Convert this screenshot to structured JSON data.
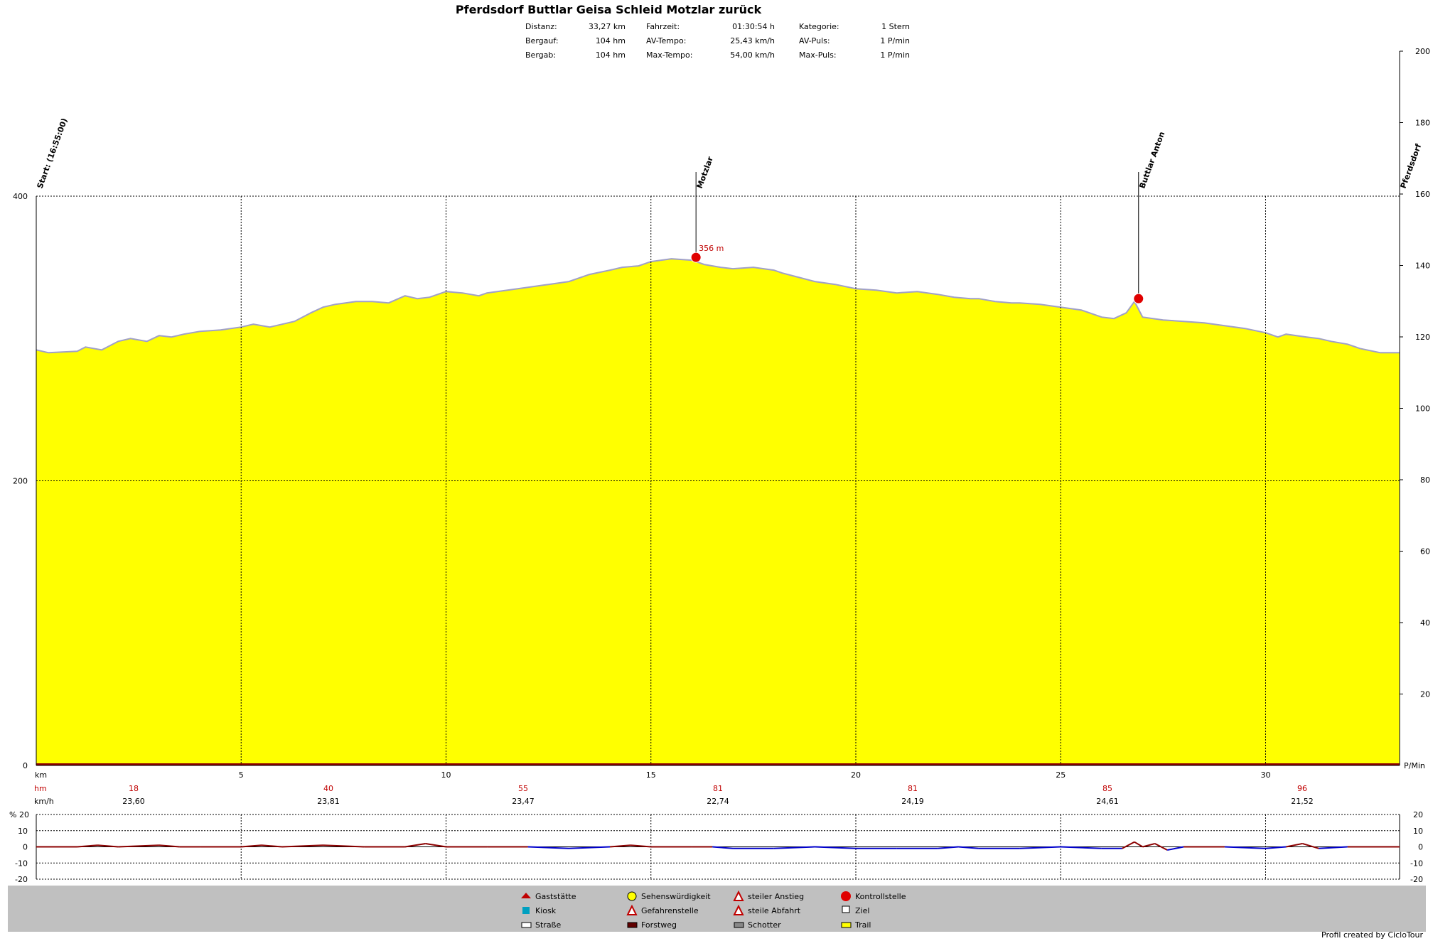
{
  "title": "Pferdsdorf Buttlar Geisa Schleid Motzlar zurück",
  "stats": [
    [
      {
        "label": "Distanz:",
        "value": "33,27 km"
      },
      {
        "label": "Fahrzeit:",
        "value": "01:30:54 h"
      },
      {
        "label": "Kategorie:",
        "value": "1 Stern"
      }
    ],
    [
      {
        "label": "Bergauf:",
        "value": "104 hm"
      },
      {
        "label": "AV-Tempo:",
        "value": "25,43 km/h"
      },
      {
        "label": "AV-Puls:",
        "value": "1 P/min"
      }
    ],
    [
      {
        "label": "Bergab:",
        "value": "104 hm"
      },
      {
        "label": "Max-Tempo:",
        "value": "54,00 km/h"
      },
      {
        "label": "Max-Puls:",
        "value": "1 P/min"
      }
    ]
  ],
  "labels": {
    "km": "km",
    "hm": "hm",
    "kmh": "km/h",
    "pmin": "P/Min",
    "percent": "% 20",
    "credit": "Profil created by CicloTour",
    "peak": "356 m"
  },
  "colors": {
    "fill": "#ffff00",
    "outline": "#a0a0c8",
    "hm_text": "#c00000",
    "legend_bg": "#c0c0c0",
    "grade_up": "#8b0000",
    "grade_down": "#0000cc"
  },
  "chart_data": [
    {
      "type": "area",
      "xlabel": "km",
      "ylabel": "",
      "xlim": [
        0,
        33.27
      ],
      "ylim": [
        0,
        400
      ],
      "y2lim": [
        0,
        200
      ],
      "x_ticks": [
        5,
        10,
        15,
        20,
        25,
        30
      ],
      "y_ticks": [
        0,
        200,
        400
      ],
      "y2_ticks": [
        20,
        40,
        60,
        80,
        100,
        120,
        140,
        160,
        180,
        200
      ],
      "grid": true,
      "elevation_profile": {
        "x": [
          0,
          0.3,
          1,
          1.2,
          1.6,
          2,
          2.3,
          2.7,
          3,
          3.3,
          3.6,
          4,
          4.5,
          5,
          5.3,
          5.7,
          6,
          6.3,
          6.7,
          7,
          7.3,
          7.8,
          8.2,
          8.6,
          9,
          9.3,
          9.6,
          10,
          10.4,
          10.8,
          11,
          11.5,
          12,
          12.5,
          13,
          13.5,
          14,
          14.3,
          14.7,
          15,
          15.5,
          16,
          16.3,
          16.7,
          17,
          17.5,
          18,
          18.2,
          18.6,
          19,
          19.5,
          20,
          20.5,
          21,
          21.5,
          22,
          22.4,
          22.8,
          23,
          23.4,
          23.8,
          24,
          24.5,
          25,
          25.5,
          26,
          26.3,
          26.6,
          26.8,
          27,
          27.5,
          28,
          28.5,
          29,
          29.5,
          30,
          30.3,
          30.5,
          31,
          31.3,
          31.6,
          32,
          32.3,
          32.8,
          33.27
        ],
        "y": [
          292,
          290,
          291,
          294,
          292,
          298,
          300,
          298,
          302,
          301,
          303,
          305,
          306,
          308,
          310,
          308,
          310,
          312,
          318,
          322,
          324,
          326,
          326,
          325,
          330,
          328,
          329,
          333,
          332,
          330,
          332,
          334,
          336,
          338,
          340,
          345,
          348,
          350,
          351,
          354,
          356,
          355,
          352,
          350,
          349,
          350,
          348,
          346,
          343,
          340,
          338,
          335,
          334,
          332,
          333,
          331,
          329,
          328,
          328,
          326,
          325,
          325,
          324,
          322,
          320,
          315,
          314,
          318,
          326,
          315,
          313,
          312,
          311,
          309,
          307,
          304,
          301,
          303,
          301,
          300,
          298,
          296,
          293,
          290,
          290
        ]
      },
      "annotations": [
        {
          "x": 0,
          "label": "Start: (16:55:00)"
        },
        {
          "x": 16.1,
          "label": "Motzlar"
        },
        {
          "x": 26.9,
          "label": "Buttlar Anton"
        },
        {
          "x": 33.27,
          "label": "Pferdsdorf"
        }
      ],
      "peak": {
        "x": 16.1,
        "y": 356,
        "label": "356 m"
      },
      "hm_values": [
        18,
        40,
        55,
        81,
        81,
        85,
        96
      ],
      "kmh_values": [
        "23,60",
        "23,81",
        "23,47",
        "22,74",
        "24,19",
        "24,61",
        "21,52"
      ]
    },
    {
      "type": "line",
      "name": "grade",
      "ylim": [
        -20,
        20
      ],
      "y_ticks": [
        20,
        10,
        0,
        -10,
        -20
      ],
      "x": [
        0,
        1,
        1.5,
        2,
        3,
        3.5,
        4,
        5,
        5.5,
        6,
        7,
        8,
        9,
        9.5,
        10,
        11,
        12,
        13,
        14,
        14.5,
        15,
        16,
        16.5,
        17,
        18,
        19,
        20,
        21,
        22,
        22.5,
        23,
        24,
        25,
        26,
        26.5,
        26.8,
        27,
        27.3,
        27.6,
        28,
        29,
        30,
        30.5,
        30.9,
        31.3,
        32,
        33.27
      ],
      "y": [
        0,
        0,
        1,
        0,
        1,
        0,
        0,
        0,
        1,
        0,
        1,
        0,
        0,
        2,
        0,
        0,
        0,
        -1,
        0,
        1,
        0,
        0,
        0,
        -1,
        -1,
        0,
        -1,
        -1,
        -1,
        0,
        -1,
        -1,
        0,
        -1,
        -1,
        3,
        0,
        2,
        -2,
        0,
        0,
        -1,
        0,
        2,
        -1,
        0,
        0
      ]
    }
  ],
  "legend": [
    {
      "icon": "gasthaus-icon",
      "label": "Gaststätte"
    },
    {
      "icon": "kiosk-icon",
      "label": "Kiosk"
    },
    {
      "icon": "strasse-icon",
      "label": "Straße"
    },
    {
      "icon": "sehenswuerdig-icon",
      "label": "Sehenswürdigkeit"
    },
    {
      "icon": "gefahr-icon",
      "label": "Gefahrenstelle"
    },
    {
      "icon": "forstweg-icon",
      "label": "Forstweg"
    },
    {
      "icon": "anstieg-icon",
      "label": "steiler Anstieg"
    },
    {
      "icon": "abfahrt-icon",
      "label": "steile Abfahrt"
    },
    {
      "icon": "schotter-icon",
      "label": "Schotter"
    },
    {
      "icon": "kontrollstelle-icon",
      "label": "Kontrollstelle"
    },
    {
      "icon": "ziel-icon",
      "label": "Ziel"
    },
    {
      "icon": "trail-icon",
      "label": "Trail"
    }
  ]
}
